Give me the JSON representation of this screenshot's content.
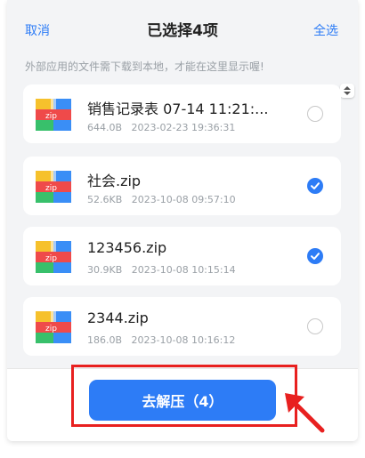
{
  "header": {
    "cancel_label": "取消",
    "title": "已选择4项",
    "select_all_label": "全选"
  },
  "notice": "外部应用的文件需下载到本地，才能在这里显示喔!",
  "files": [
    {
      "name": "销售记录表  07-14 11:21:...",
      "size": "644.0B",
      "date": "2023-02-23 19:36:31",
      "checked": false
    },
    {
      "name": "社会.zip",
      "size": "52.6KB",
      "date": "2023-10-08 09:57:10",
      "checked": true
    },
    {
      "name": "123456.zip",
      "size": "30.9KB",
      "date": "2023-10-08 10:15:14",
      "checked": true
    },
    {
      "name": "2344.zip",
      "size": "186.0B",
      "date": "2023-10-08 10:16:12",
      "checked": false
    }
  ],
  "icon_label": "zip",
  "extract_button_label": "去解压（4）",
  "colors": {
    "accent": "#2d7cf6",
    "annotation": "#e8201f",
    "zip_yellow": "#f6c12c",
    "zip_red": "#ef4a4a",
    "zip_green": "#38c06b",
    "zip_blue": "#3a8ef6"
  }
}
